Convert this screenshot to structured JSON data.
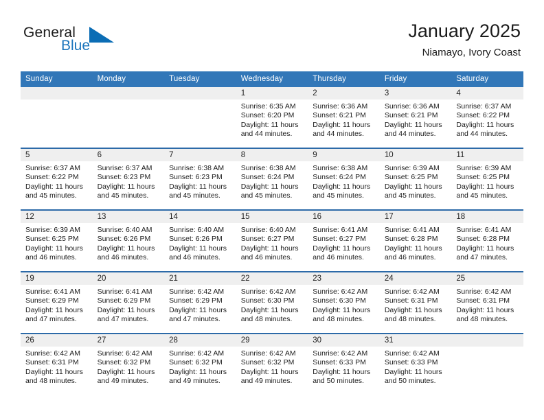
{
  "brand": {
    "name_line1": "General",
    "name_line2": "Blue",
    "logo_icon": "blue-triangle-icon",
    "color_primary": "#1c75bc",
    "color_dark": "#1b1b1b"
  },
  "header": {
    "title": "January 2025",
    "subtitle": "Niamayo, Ivory Coast"
  },
  "calendar": {
    "header_bg": "#3277b8",
    "row_divider": "#2c6aa8",
    "daynum_bg": "#efefef",
    "weekday_headers": [
      "Sunday",
      "Monday",
      "Tuesday",
      "Wednesday",
      "Thursday",
      "Friday",
      "Saturday"
    ],
    "weeks": [
      [
        {
          "day": "",
          "sunrise": "",
          "sunset": "",
          "daylight": "",
          "daylight2": ""
        },
        {
          "day": "",
          "sunrise": "",
          "sunset": "",
          "daylight": "",
          "daylight2": ""
        },
        {
          "day": "",
          "sunrise": "",
          "sunset": "",
          "daylight": "",
          "daylight2": ""
        },
        {
          "day": "1",
          "sunrise": "Sunrise: 6:35 AM",
          "sunset": "Sunset: 6:20 PM",
          "daylight": "Daylight: 11 hours",
          "daylight2": "and 44 minutes."
        },
        {
          "day": "2",
          "sunrise": "Sunrise: 6:36 AM",
          "sunset": "Sunset: 6:21 PM",
          "daylight": "Daylight: 11 hours",
          "daylight2": "and 44 minutes."
        },
        {
          "day": "3",
          "sunrise": "Sunrise: 6:36 AM",
          "sunset": "Sunset: 6:21 PM",
          "daylight": "Daylight: 11 hours",
          "daylight2": "and 44 minutes."
        },
        {
          "day": "4",
          "sunrise": "Sunrise: 6:37 AM",
          "sunset": "Sunset: 6:22 PM",
          "daylight": "Daylight: 11 hours",
          "daylight2": "and 44 minutes."
        }
      ],
      [
        {
          "day": "5",
          "sunrise": "Sunrise: 6:37 AM",
          "sunset": "Sunset: 6:22 PM",
          "daylight": "Daylight: 11 hours",
          "daylight2": "and 45 minutes."
        },
        {
          "day": "6",
          "sunrise": "Sunrise: 6:37 AM",
          "sunset": "Sunset: 6:23 PM",
          "daylight": "Daylight: 11 hours",
          "daylight2": "and 45 minutes."
        },
        {
          "day": "7",
          "sunrise": "Sunrise: 6:38 AM",
          "sunset": "Sunset: 6:23 PM",
          "daylight": "Daylight: 11 hours",
          "daylight2": "and 45 minutes."
        },
        {
          "day": "8",
          "sunrise": "Sunrise: 6:38 AM",
          "sunset": "Sunset: 6:24 PM",
          "daylight": "Daylight: 11 hours",
          "daylight2": "and 45 minutes."
        },
        {
          "day": "9",
          "sunrise": "Sunrise: 6:38 AM",
          "sunset": "Sunset: 6:24 PM",
          "daylight": "Daylight: 11 hours",
          "daylight2": "and 45 minutes."
        },
        {
          "day": "10",
          "sunrise": "Sunrise: 6:39 AM",
          "sunset": "Sunset: 6:25 PM",
          "daylight": "Daylight: 11 hours",
          "daylight2": "and 45 minutes."
        },
        {
          "day": "11",
          "sunrise": "Sunrise: 6:39 AM",
          "sunset": "Sunset: 6:25 PM",
          "daylight": "Daylight: 11 hours",
          "daylight2": "and 45 minutes."
        }
      ],
      [
        {
          "day": "12",
          "sunrise": "Sunrise: 6:39 AM",
          "sunset": "Sunset: 6:25 PM",
          "daylight": "Daylight: 11 hours",
          "daylight2": "and 46 minutes."
        },
        {
          "day": "13",
          "sunrise": "Sunrise: 6:40 AM",
          "sunset": "Sunset: 6:26 PM",
          "daylight": "Daylight: 11 hours",
          "daylight2": "and 46 minutes."
        },
        {
          "day": "14",
          "sunrise": "Sunrise: 6:40 AM",
          "sunset": "Sunset: 6:26 PM",
          "daylight": "Daylight: 11 hours",
          "daylight2": "and 46 minutes."
        },
        {
          "day": "15",
          "sunrise": "Sunrise: 6:40 AM",
          "sunset": "Sunset: 6:27 PM",
          "daylight": "Daylight: 11 hours",
          "daylight2": "and 46 minutes."
        },
        {
          "day": "16",
          "sunrise": "Sunrise: 6:41 AM",
          "sunset": "Sunset: 6:27 PM",
          "daylight": "Daylight: 11 hours",
          "daylight2": "and 46 minutes."
        },
        {
          "day": "17",
          "sunrise": "Sunrise: 6:41 AM",
          "sunset": "Sunset: 6:28 PM",
          "daylight": "Daylight: 11 hours",
          "daylight2": "and 46 minutes."
        },
        {
          "day": "18",
          "sunrise": "Sunrise: 6:41 AM",
          "sunset": "Sunset: 6:28 PM",
          "daylight": "Daylight: 11 hours",
          "daylight2": "and 47 minutes."
        }
      ],
      [
        {
          "day": "19",
          "sunrise": "Sunrise: 6:41 AM",
          "sunset": "Sunset: 6:29 PM",
          "daylight": "Daylight: 11 hours",
          "daylight2": "and 47 minutes."
        },
        {
          "day": "20",
          "sunrise": "Sunrise: 6:41 AM",
          "sunset": "Sunset: 6:29 PM",
          "daylight": "Daylight: 11 hours",
          "daylight2": "and 47 minutes."
        },
        {
          "day": "21",
          "sunrise": "Sunrise: 6:42 AM",
          "sunset": "Sunset: 6:29 PM",
          "daylight": "Daylight: 11 hours",
          "daylight2": "and 47 minutes."
        },
        {
          "day": "22",
          "sunrise": "Sunrise: 6:42 AM",
          "sunset": "Sunset: 6:30 PM",
          "daylight": "Daylight: 11 hours",
          "daylight2": "and 48 minutes."
        },
        {
          "day": "23",
          "sunrise": "Sunrise: 6:42 AM",
          "sunset": "Sunset: 6:30 PM",
          "daylight": "Daylight: 11 hours",
          "daylight2": "and 48 minutes."
        },
        {
          "day": "24",
          "sunrise": "Sunrise: 6:42 AM",
          "sunset": "Sunset: 6:31 PM",
          "daylight": "Daylight: 11 hours",
          "daylight2": "and 48 minutes."
        },
        {
          "day": "25",
          "sunrise": "Sunrise: 6:42 AM",
          "sunset": "Sunset: 6:31 PM",
          "daylight": "Daylight: 11 hours",
          "daylight2": "and 48 minutes."
        }
      ],
      [
        {
          "day": "26",
          "sunrise": "Sunrise: 6:42 AM",
          "sunset": "Sunset: 6:31 PM",
          "daylight": "Daylight: 11 hours",
          "daylight2": "and 48 minutes."
        },
        {
          "day": "27",
          "sunrise": "Sunrise: 6:42 AM",
          "sunset": "Sunset: 6:32 PM",
          "daylight": "Daylight: 11 hours",
          "daylight2": "and 49 minutes."
        },
        {
          "day": "28",
          "sunrise": "Sunrise: 6:42 AM",
          "sunset": "Sunset: 6:32 PM",
          "daylight": "Daylight: 11 hours",
          "daylight2": "and 49 minutes."
        },
        {
          "day": "29",
          "sunrise": "Sunrise: 6:42 AM",
          "sunset": "Sunset: 6:32 PM",
          "daylight": "Daylight: 11 hours",
          "daylight2": "and 49 minutes."
        },
        {
          "day": "30",
          "sunrise": "Sunrise: 6:42 AM",
          "sunset": "Sunset: 6:33 PM",
          "daylight": "Daylight: 11 hours",
          "daylight2": "and 50 minutes."
        },
        {
          "day": "31",
          "sunrise": "Sunrise: 6:42 AM",
          "sunset": "Sunset: 6:33 PM",
          "daylight": "Daylight: 11 hours",
          "daylight2": "and 50 minutes."
        },
        {
          "day": "",
          "sunrise": "",
          "sunset": "",
          "daylight": "",
          "daylight2": ""
        }
      ]
    ]
  }
}
